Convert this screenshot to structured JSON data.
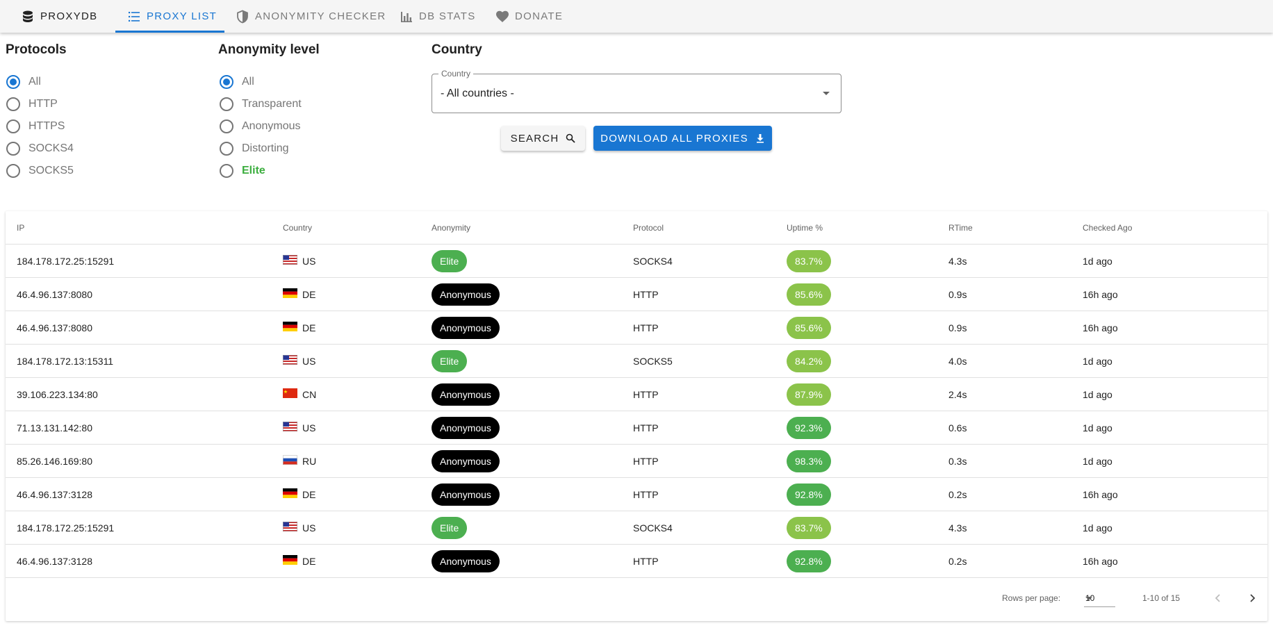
{
  "nav": {
    "brand": "PROXYDB",
    "items": [
      {
        "label": "PROXY LIST",
        "icon": "list-icon",
        "active": true
      },
      {
        "label": "ANONYMITY CHECKER",
        "icon": "shield-icon",
        "active": false
      },
      {
        "label": "DB STATS",
        "icon": "bar-chart-icon",
        "active": false
      },
      {
        "label": "DONATE",
        "icon": "heart-icon",
        "active": false
      }
    ]
  },
  "filters": {
    "protocols": {
      "title": "Protocols",
      "options": [
        "All",
        "HTTP",
        "HTTPS",
        "SOCKS4",
        "SOCKS5"
      ],
      "selected": "All"
    },
    "anonymity": {
      "title": "Anonymity level",
      "options": [
        "All",
        "Transparent",
        "Anonymous",
        "Distorting",
        "Elite"
      ],
      "selected": "All"
    },
    "country": {
      "title": "Country",
      "field_label": "Country",
      "value": "- All countries -"
    }
  },
  "actions": {
    "search_label": "SEARCH",
    "download_label": "DOWNLOAD ALL PROXIES"
  },
  "table": {
    "columns": [
      "IP",
      "Country",
      "Anonymity",
      "Protocol",
      "Uptime %",
      "RTime",
      "Checked Ago"
    ],
    "rows": [
      {
        "ip": "184.178.172.25:15291",
        "country": "US",
        "anonymity": "Elite",
        "protocol": "SOCKS4",
        "uptime": "83.7%",
        "rtime": "4.3s",
        "checked": "1d ago"
      },
      {
        "ip": "46.4.96.137:8080",
        "country": "DE",
        "anonymity": "Anonymous",
        "protocol": "HTTP",
        "uptime": "85.6%",
        "rtime": "0.9s",
        "checked": "16h ago"
      },
      {
        "ip": "46.4.96.137:8080",
        "country": "DE",
        "anonymity": "Anonymous",
        "protocol": "HTTP",
        "uptime": "85.6%",
        "rtime": "0.9s",
        "checked": "16h ago"
      },
      {
        "ip": "184.178.172.13:15311",
        "country": "US",
        "anonymity": "Elite",
        "protocol": "SOCKS5",
        "uptime": "84.2%",
        "rtime": "4.0s",
        "checked": "1d ago"
      },
      {
        "ip": "39.106.223.134:80",
        "country": "CN",
        "anonymity": "Anonymous",
        "protocol": "HTTP",
        "uptime": "87.9%",
        "rtime": "2.4s",
        "checked": "1d ago"
      },
      {
        "ip": "71.13.131.142:80",
        "country": "US",
        "anonymity": "Anonymous",
        "protocol": "HTTP",
        "uptime": "92.3%",
        "rtime": "0.6s",
        "checked": "1d ago"
      },
      {
        "ip": "85.26.146.169:80",
        "country": "RU",
        "anonymity": "Anonymous",
        "protocol": "HTTP",
        "uptime": "98.3%",
        "rtime": "0.3s",
        "checked": "1d ago"
      },
      {
        "ip": "46.4.96.137:3128",
        "country": "DE",
        "anonymity": "Anonymous",
        "protocol": "HTTP",
        "uptime": "92.8%",
        "rtime": "0.2s",
        "checked": "16h ago"
      },
      {
        "ip": "184.178.172.25:15291",
        "country": "US",
        "anonymity": "Elite",
        "protocol": "SOCKS4",
        "uptime": "83.7%",
        "rtime": "4.3s",
        "checked": "1d ago"
      },
      {
        "ip": "46.4.96.137:3128",
        "country": "DE",
        "anonymity": "Anonymous",
        "protocol": "HTTP",
        "uptime": "92.8%",
        "rtime": "0.2s",
        "checked": "16h ago"
      }
    ]
  },
  "pagination": {
    "rows_per_page_label": "Rows per page:",
    "rows_per_page": "10",
    "range": "1-10 of 15"
  },
  "colors": {
    "accent": "#1976d2",
    "elite_green": "#4caf50",
    "uptime_light_green": "#8bc34a",
    "anonymous_black": "#000000"
  }
}
